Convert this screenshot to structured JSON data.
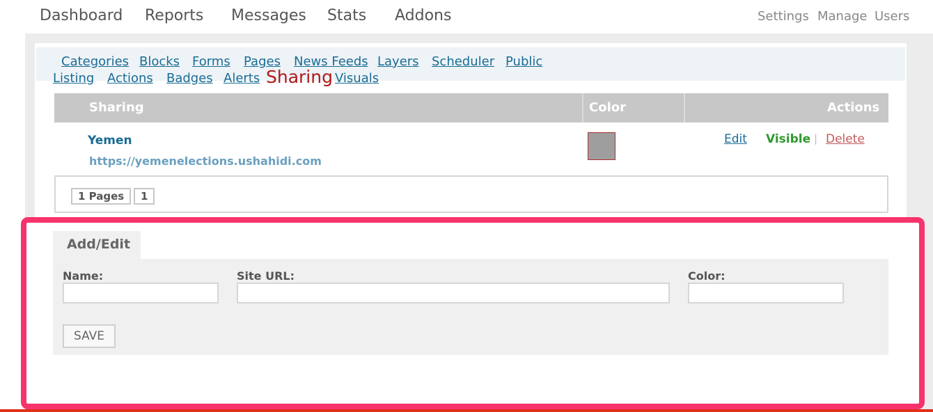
{
  "main_nav": [
    "Dashboard",
    "Reports",
    "Messages",
    "Stats",
    "Addons"
  ],
  "side_nav": [
    "Settings",
    "Manage",
    "Users"
  ],
  "sub_nav": {
    "items": [
      "Categories",
      "Blocks",
      "Forms",
      "Pages",
      "News Feeds",
      "Layers",
      "Scheduler",
      "Public Listing",
      "Actions",
      "Badges",
      "Alerts"
    ],
    "public_line1": "Public",
    "public_line2": "Listing",
    "active": "Sharing",
    "after_active": "Visuals"
  },
  "table": {
    "headers": [
      "Sharing",
      "Color",
      "Actions"
    ],
    "rows": [
      {
        "name": "Yemen",
        "url": "https://yemenelections.ushahidi.com",
        "color": "#9e9e9e",
        "actions": {
          "edit": "Edit",
          "visible": "Visible",
          "separator": "|",
          "delete": "Delete"
        }
      }
    ]
  },
  "pagination": {
    "pages_label": "1 Pages",
    "current": "1"
  },
  "form": {
    "tab_label": "Add/Edit",
    "fields": {
      "name": {
        "label": "Name:",
        "value": ""
      },
      "site_url": {
        "label": "Site URL:",
        "value": ""
      },
      "color": {
        "label": "Color:",
        "value": ""
      }
    },
    "save_label": "SAVE"
  },
  "colors": {
    "link": "#1a6c95",
    "active": "#b01818",
    "visible": "#2e9a2e",
    "delete": "#c45a5a",
    "highlight": "#f7336b"
  }
}
